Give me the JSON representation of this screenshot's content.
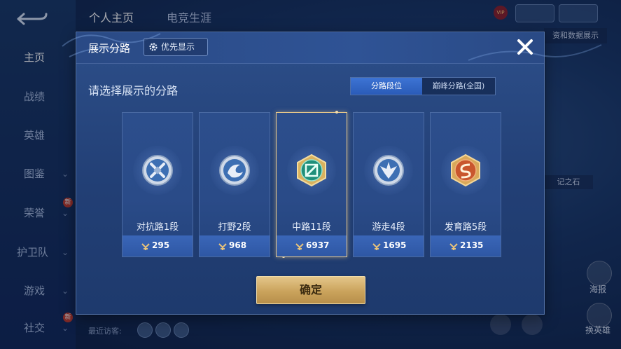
{
  "background": {
    "top_tabs": [
      "个人主页",
      "电竞生涯"
    ],
    "sidebar_items": [
      {
        "label": "主页",
        "active": true,
        "chevron": false
      },
      {
        "label": "战绩",
        "active": false,
        "chevron": false
      },
      {
        "label": "英雄",
        "active": false,
        "chevron": false
      },
      {
        "label": "图鉴",
        "active": false,
        "chevron": true
      },
      {
        "label": "荣誉",
        "active": false,
        "chevron": true
      },
      {
        "label": "护卫队",
        "active": false,
        "chevron": true
      },
      {
        "label": "游戏",
        "active": false,
        "chevron": true
      },
      {
        "label": "社交",
        "active": false,
        "chevron": true
      }
    ],
    "sidebar_badges": [
      "新",
      "新"
    ],
    "vip_label": "VIP",
    "right_chip": "资和数据展示",
    "right_chip2": "记之石",
    "right_label_1": "海报",
    "right_label_2": "换英雄",
    "recent_visitors": "最近访客:"
  },
  "dialog": {
    "title": "展示分路",
    "priority_button": "优先显示",
    "prompt": "请选择展示的分路",
    "toggle": {
      "options": [
        "分路段位",
        "巅峰分路(全国)"
      ],
      "active_index": 0
    },
    "cards": [
      {
        "label": "对抗路1段",
        "score": "295",
        "emblem": "clash-lane-emblem",
        "selected": false
      },
      {
        "label": "打野2段",
        "score": "968",
        "emblem": "jungle-emblem",
        "selected": false
      },
      {
        "label": "中路11段",
        "score": "6937",
        "emblem": "mid-lane-emblem",
        "selected": true
      },
      {
        "label": "游走4段",
        "score": "1695",
        "emblem": "roam-emblem",
        "selected": false
      },
      {
        "label": "发育路5段",
        "score": "2135",
        "emblem": "farm-lane-emblem",
        "selected": false
      }
    ],
    "confirm_button": "确定"
  },
  "colors": {
    "accent_gold": "#e9c98a",
    "toggle_active": "#2f62c2",
    "dialog_bg": "#243f75"
  }
}
